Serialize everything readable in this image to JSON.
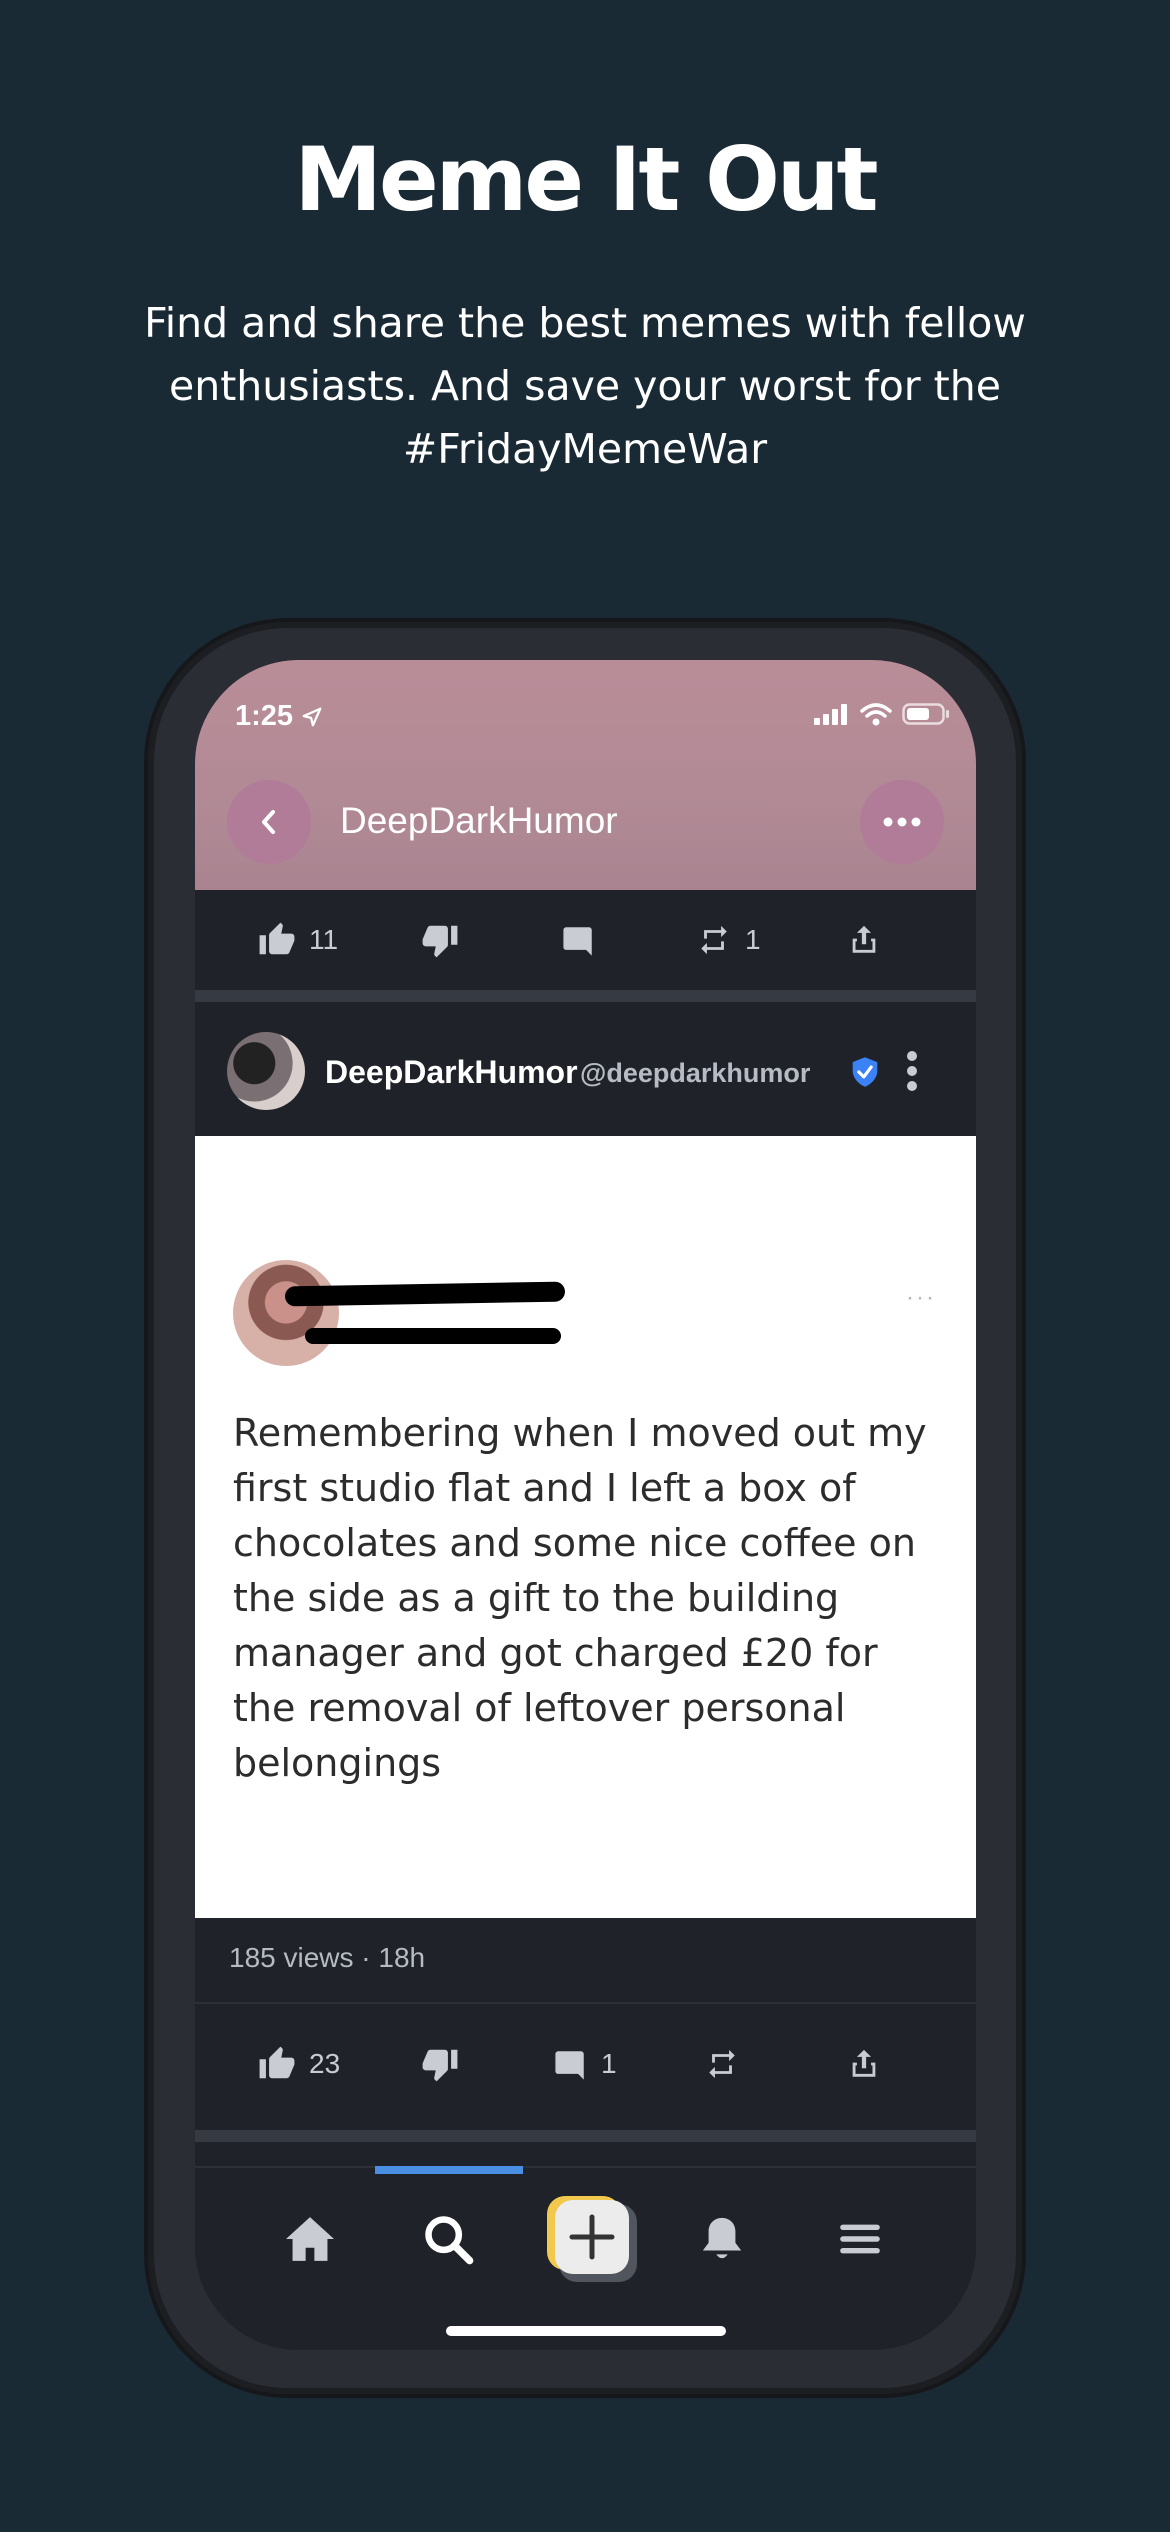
{
  "promo": {
    "headline": "Meme It Out",
    "subtitle": "Find and share the best memes with fellow enthusiasts. And save your worst for the #FridayMemeWar"
  },
  "status_bar": {
    "time": "1:25"
  },
  "nav": {
    "title": "DeepDarkHumor"
  },
  "previous_post_actions": {
    "likes": "11",
    "reposts": "1"
  },
  "post": {
    "author_name": "DeepDarkHumor",
    "author_handle": "@deepdarkhumor",
    "meme_text": "Remembering when I moved out my first studio flat and I left a box of chocolates and some nice coffee on the side as a gift to the building manager and got charged £20 for the removal of leftover personal belongings",
    "meta": "185 views · 18h",
    "likes": "23",
    "comments": "1"
  },
  "tabbar": {
    "items": [
      "home-icon",
      "search-icon",
      "create-post-icon",
      "notifications-icon",
      "menu-icon"
    ],
    "active": "search-icon"
  },
  "colors": {
    "background": "#192a35",
    "header_tint": "#b98d98",
    "accent": "#4a90e2",
    "create_button": "#f2c94c"
  }
}
